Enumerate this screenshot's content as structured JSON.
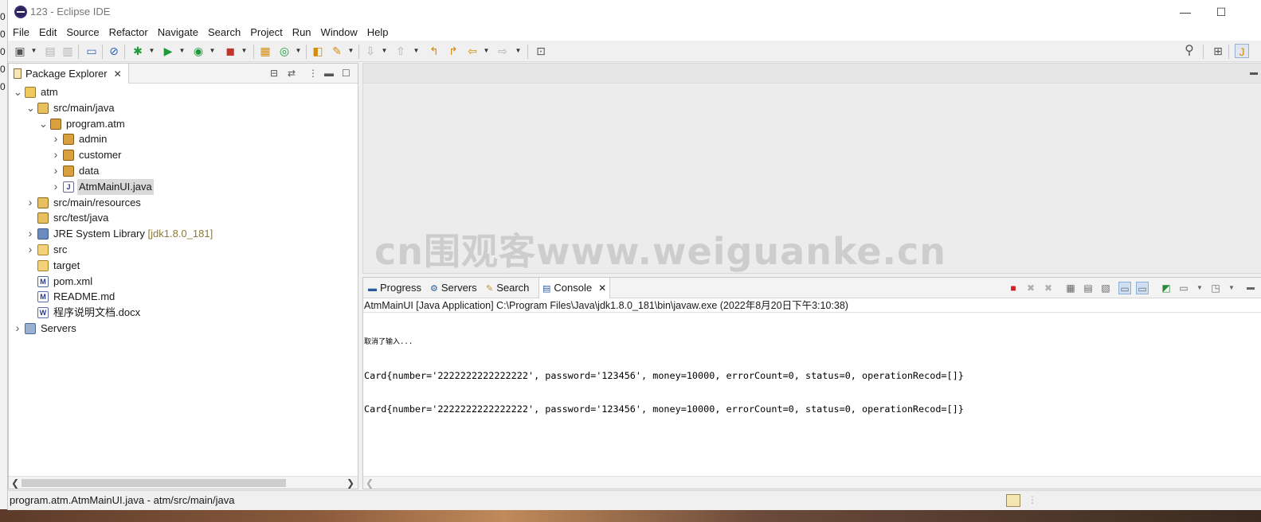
{
  "desktop": {
    "left_chars": [
      "0",
      "0",
      "0",
      "0",
      "0"
    ]
  },
  "window": {
    "title": "123 - Eclipse IDE",
    "minimize": "—",
    "maximize": "☐"
  },
  "menu": [
    "File",
    "Edit",
    "Source",
    "Refactor",
    "Navigate",
    "Search",
    "Project",
    "Run",
    "Window",
    "Help"
  ],
  "toolbar": {
    "quick_access_icon": "search-icon",
    "perspective_icon": "java-perspective-icon"
  },
  "explorer": {
    "tab_label": "Package Explorer",
    "close": "✕",
    "tree": [
      {
        "label": "atm",
        "icon": "project-icon",
        "depth": 0,
        "twisty": "expanded"
      },
      {
        "label": "src/main/java",
        "icon": "source-folder-icon",
        "depth": 1,
        "twisty": "expanded"
      },
      {
        "label": "program.atm",
        "icon": "package-icon",
        "depth": 2,
        "twisty": "expanded"
      },
      {
        "label": "admin",
        "icon": "package-icon",
        "depth": 3,
        "twisty": "collapsed"
      },
      {
        "label": "customer",
        "icon": "package-icon",
        "depth": 3,
        "twisty": "collapsed"
      },
      {
        "label": "data",
        "icon": "package-icon",
        "depth": 3,
        "twisty": "collapsed"
      },
      {
        "label": "AtmMainUI.java",
        "icon": "java-file-icon",
        "depth": 3,
        "twisty": "collapsed",
        "selected": true
      },
      {
        "label": "src/main/resources",
        "icon": "source-folder-icon",
        "depth": 1,
        "twisty": "collapsed"
      },
      {
        "label": "src/test/java",
        "icon": "source-folder-icon",
        "depth": 1,
        "twisty": "none"
      },
      {
        "label": "JRE System Library",
        "decoration": "[jdk1.8.0_181]",
        "icon": "library-icon",
        "depth": 1,
        "twisty": "collapsed"
      },
      {
        "label": "src",
        "icon": "folder-icon",
        "depth": 1,
        "twisty": "collapsed"
      },
      {
        "label": "target",
        "icon": "folder-icon",
        "depth": 1,
        "twisty": "none"
      },
      {
        "label": "pom.xml",
        "icon": "maven-file-icon",
        "depth": 1,
        "twisty": "none"
      },
      {
        "label": "README.md",
        "icon": "markdown-file-icon",
        "depth": 1,
        "twisty": "none"
      },
      {
        "label": "程序说明文档.docx",
        "icon": "word-file-icon",
        "depth": 1,
        "twisty": "none"
      },
      {
        "label": "Servers",
        "icon": "servers-icon",
        "depth": 0,
        "twisty": "collapsed"
      }
    ]
  },
  "watermark": "cn围观客www.weiguanke.cn",
  "console": {
    "tabs": [
      {
        "label": "Progress",
        "icon": "progress-icon"
      },
      {
        "label": "Servers",
        "icon": "servers-icon"
      },
      {
        "label": "Search",
        "icon": "search-icon"
      },
      {
        "label": "Console",
        "icon": "console-icon",
        "active": true
      }
    ],
    "close": "✕",
    "description": "AtmMainUI [Java Application] C:\\Program Files\\Java\\jdk1.8.0_181\\bin\\javaw.exe  (2022年8月20日下午3:10:38)",
    "output": [
      "取消了输入...",
      "Card{number='2222222222222222', password='123456', money=10000, errorCount=0, status=0, operationRecod=[]}",
      "Card{number='2222222222222222', password='123456', money=10000, errorCount=0, status=0, operationRecod=[]}"
    ]
  },
  "status": {
    "text": "program.atm.AtmMainUI.java - atm/src/main/java"
  }
}
